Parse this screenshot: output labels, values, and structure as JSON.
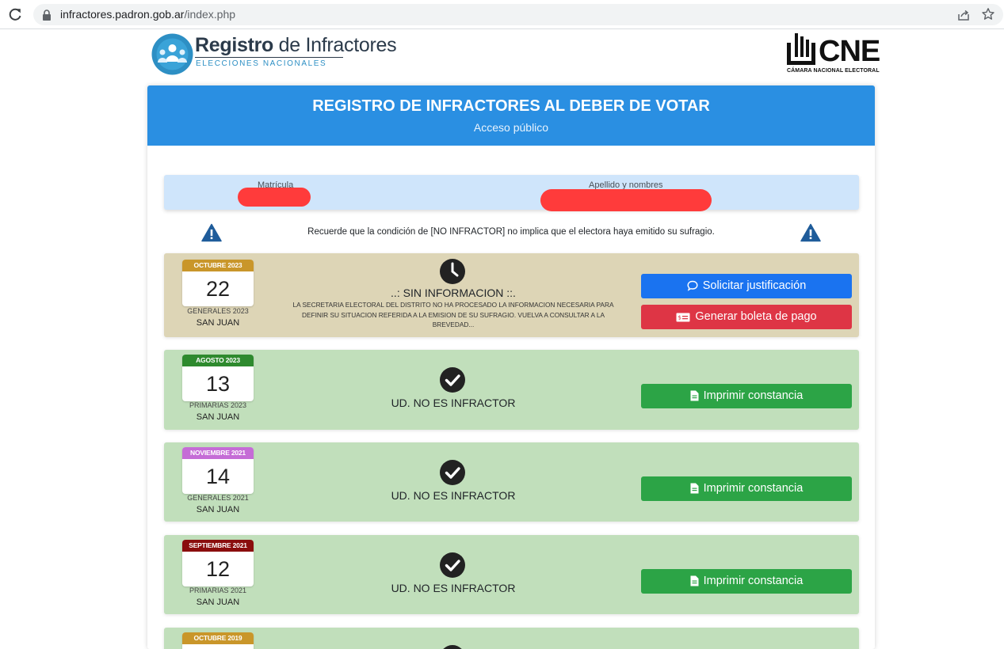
{
  "browser": {
    "url_host": "infractores.padron.gob.ar",
    "url_path": "/index.php"
  },
  "header": {
    "brand_bold": "Registro",
    "brand_light": " de Infractores",
    "brand_sub": "ELECCIONES NACIONALES",
    "cne_text": "CNE",
    "cne_sub": "CÁMARA NACIONAL ELECTORAL"
  },
  "card": {
    "title": "REGISTRO DE INFRACTORES AL DEBER DE VOTAR",
    "subtitle": "Acceso público"
  },
  "info": {
    "matricula_label": "Matrícula",
    "name_label": "Apellido y nombres"
  },
  "warning": "Recuerde que la condición de [NO INFRACTOR] no implica que el electora haya emitido su sufragio.",
  "rows": [
    {
      "month": "OCTUBRE 2023",
      "month_color": "#c9962a",
      "day": "22",
      "type": "GENERALES 2023",
      "place": "SAN JUAN",
      "status": "..: SIN INFORMACION ::.",
      "desc": "LA SECRETARIA ELECTORAL DEL DISTRITO NO HA PROCESADO LA INFORMACION NECESARIA PARA DEFINIR SU SITUACION REFERIDA A LA EMISION DE SU SUFRAGIO. VUELVA A CONSULTAR A LA BREVEDAD...",
      "btn1": "Solicitar justificación",
      "btn2": "Generar boleta de pago"
    },
    {
      "month": "AGOSTO 2023",
      "month_color": "#2e8a2e",
      "day": "13",
      "type": "PRIMARIAS 2023",
      "place": "SAN JUAN",
      "status": "UD. NO ES INFRACTOR",
      "btn": "Imprimir constancia"
    },
    {
      "month": "NOVIEMBRE 2021",
      "month_color": "#c56cd6",
      "day": "14",
      "type": "GENERALES 2021",
      "place": "SAN JUAN",
      "status": "UD. NO ES INFRACTOR",
      "btn": "Imprimir constancia"
    },
    {
      "month": "SEPTIEMBRE 2021",
      "month_color": "#8a0d0d",
      "day": "12",
      "type": "PRIMARIAS 2021",
      "place": "SAN JUAN",
      "status": "UD. NO ES INFRACTOR",
      "btn": "Imprimir constancia"
    },
    {
      "month": "OCTUBRE 2019",
      "month_color": "#c9962a"
    }
  ],
  "colors": {
    "header_blue": "#2a8fe2",
    "info_blue": "#cfe5fb",
    "beige": "#ddd5b6",
    "green_row": "#c1dfbb",
    "btn_blue": "#1a73f0",
    "btn_red": "#de3545",
    "btn_green": "#2ca446"
  },
  "icons": {
    "reload": "reload-icon",
    "lock": "lock-icon",
    "share": "share-icon",
    "star": "bookmark-star-icon",
    "warning": "warning-triangle-icon",
    "clock": "clock-icon",
    "check": "check-circle-icon",
    "chat": "chat-bubble-icon",
    "money": "banknote-icon",
    "file": "file-icon"
  }
}
